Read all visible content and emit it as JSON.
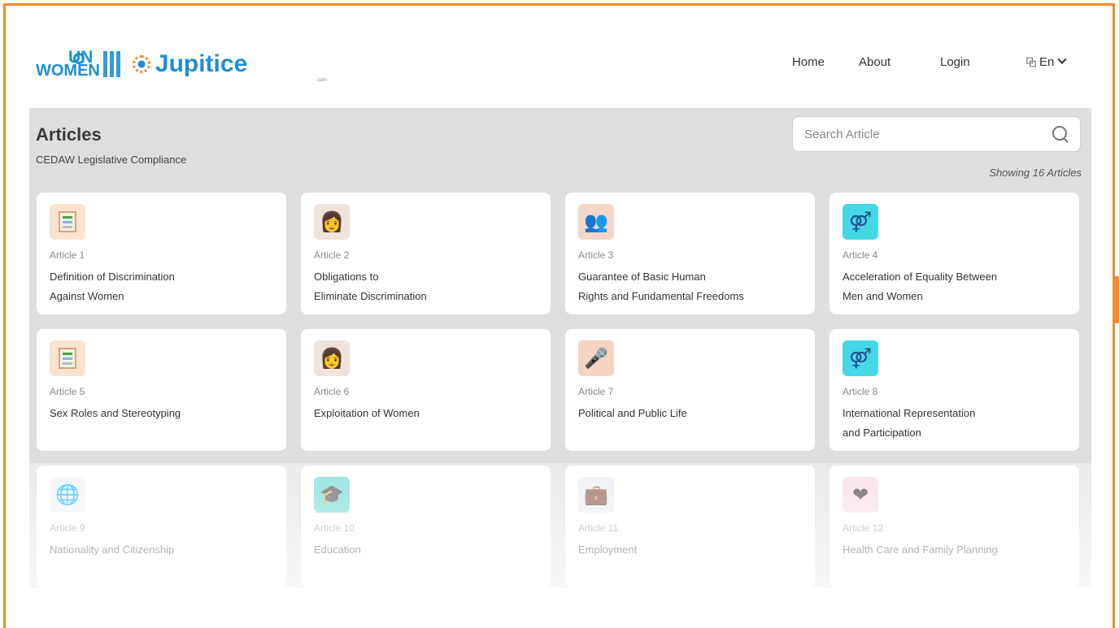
{
  "header": {
    "logo_un": "UN",
    "logo_women": "WOMEN",
    "logo_jupitice": "Jupitice",
    "logo_jupitice_sub": ".com",
    "nav": {
      "home": "Home",
      "about": "About",
      "login": "Login",
      "language": "En"
    }
  },
  "page": {
    "title": "Articles",
    "subtitle": "CEDAW Legislative Compliance",
    "search_placeholder": "Search Article",
    "showing_prefix": "Showing",
    "showing_count": "16 Articles"
  },
  "articles": [
    {
      "num": "Article 1",
      "name": "Definition of Discrimination\nAgainst Women",
      "icon": "document-icon"
    },
    {
      "num": "Article 2",
      "name": "Obligations to\nEliminate Discrimination",
      "icon": "people-icon"
    },
    {
      "num": "Article 3",
      "name": "Guarantee of Basic Human\nRights and Fundamental Freedoms",
      "icon": "crowd-icon"
    },
    {
      "num": "Article 4",
      "name": "Acceleration of Equality Between\nMen and Women",
      "icon": "gender-icon"
    },
    {
      "num": "Article 5",
      "name": "Sex Roles and Stereotyping",
      "icon": "document-icon"
    },
    {
      "num": "Article 6",
      "name": "Exploitation of Women",
      "icon": "people-icon"
    },
    {
      "num": "Article 7",
      "name": "Political and Public Life",
      "icon": "podium-icon"
    },
    {
      "num": "Article 8",
      "name": "International Representation\nand Participation",
      "icon": "gender-icon"
    },
    {
      "num": "Article 9",
      "name": "Nationality and Citizenship",
      "icon": "globe-icon"
    },
    {
      "num": "Article 10",
      "name": "Education",
      "icon": "education-icon"
    },
    {
      "num": "Article 11",
      "name": "Employment",
      "icon": "employment-icon"
    },
    {
      "num": "Article 12",
      "name": "Health Care and Family Planning",
      "icon": "health-icon"
    }
  ],
  "colors": {
    "accent": "#f08a32",
    "brand": "#1f8ed6",
    "panel": "#dedede"
  }
}
